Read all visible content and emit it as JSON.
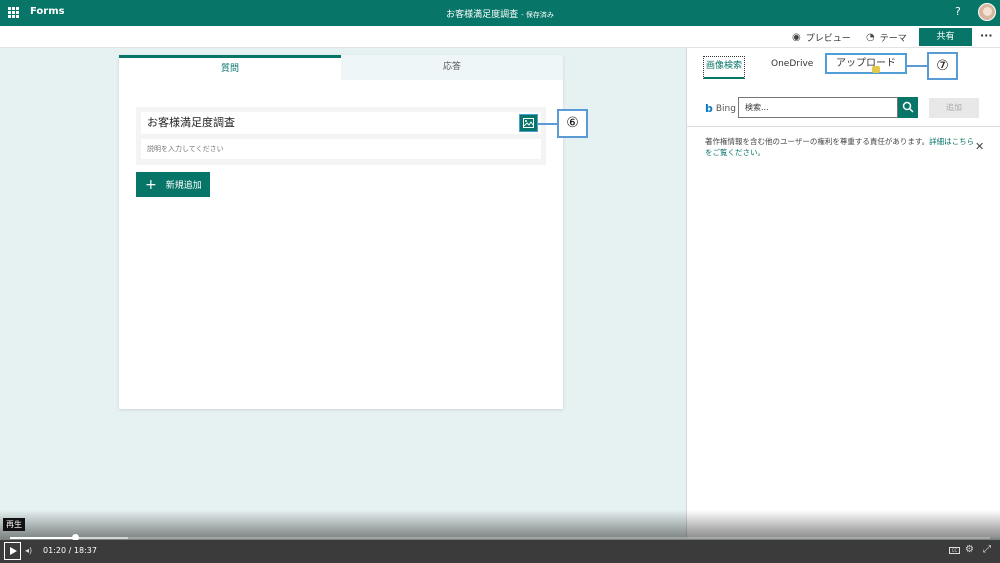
{
  "header": {
    "app_name": "Forms",
    "doc_title": "お客様満足度調査",
    "save_status": "- 保存済み",
    "help": "?"
  },
  "toolbar": {
    "preview_label": "プレビュー",
    "theme_label": "テーマ",
    "share_label": "共有",
    "more_label": "···"
  },
  "form": {
    "tabs": [
      {
        "label": "質問"
      },
      {
        "label": "応答"
      }
    ],
    "title": "お客様満足度調査",
    "description_placeholder": "説明を入力してください",
    "add_new_label": "新規追加"
  },
  "callouts": {
    "image_button": "⑥",
    "upload_tab": "⑦"
  },
  "image_panel": {
    "tabs": [
      {
        "label": "画像検索"
      },
      {
        "label": "OneDrive"
      },
      {
        "label": "アップロード"
      }
    ],
    "provider": "Bing",
    "search_placeholder": "検索...",
    "add_button": "追加",
    "notice_text": "著作権情報を含む他のユーザーの権利を尊重する責任があります。",
    "notice_link": "詳細はこちらをご覧ください。"
  },
  "video": {
    "tooltip": "再生",
    "current_time": "01:20",
    "separator": "/",
    "duration": "18:37",
    "progress_fraction": 0.066,
    "cc_label": "CC"
  },
  "colors": {
    "brand": "#077568",
    "callout_border": "#5b9bd5"
  }
}
